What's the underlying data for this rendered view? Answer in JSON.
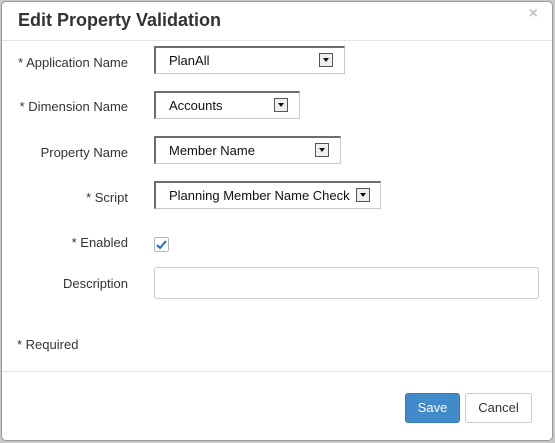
{
  "dialog": {
    "title": "Edit Property Validation",
    "close_glyph": "×"
  },
  "form": {
    "application_name": {
      "label": "* Application Name",
      "value": "PlanAll"
    },
    "dimension_name": {
      "label": "* Dimension Name",
      "value": "Accounts"
    },
    "property_name": {
      "label": "Property Name",
      "value": "Member Name"
    },
    "script": {
      "label": "* Script",
      "value": "Planning Member Name Check"
    },
    "enabled": {
      "label": "* Enabled",
      "checked": true
    },
    "description": {
      "label": "Description",
      "value": "",
      "placeholder": ""
    }
  },
  "required_note": "* Required",
  "footer": {
    "save_label": "Save",
    "cancel_label": "Cancel"
  },
  "colors": {
    "primary": "#428bca",
    "checkmark": "#2a6ab8"
  }
}
